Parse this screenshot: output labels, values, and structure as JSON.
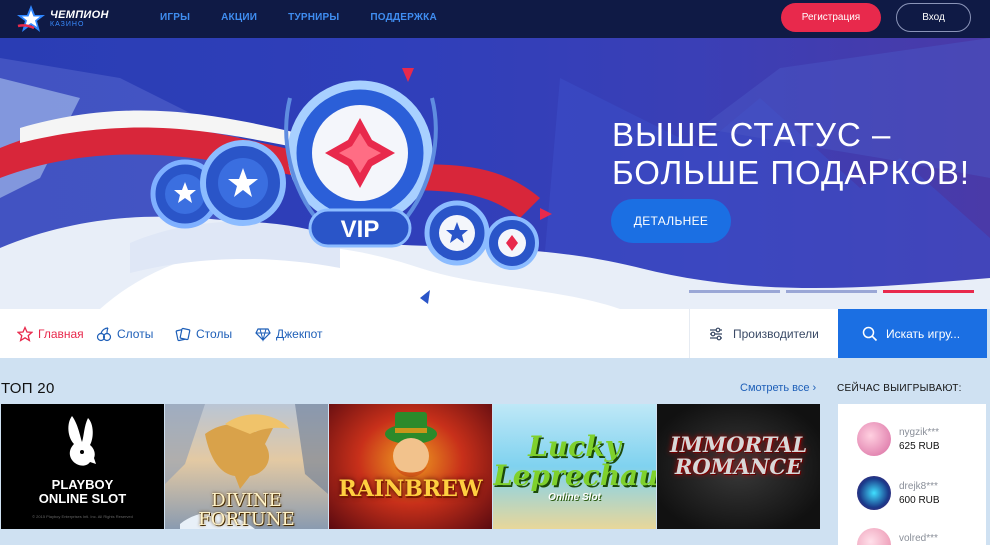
{
  "header": {
    "logo_main": "ЧЕМПИОН",
    "logo_sub": "КАЗИНО",
    "nav": [
      "ИГРЫ",
      "АКЦИИ",
      "ТУРНИРЫ",
      "ПОДДЕРЖКА"
    ],
    "register_label": "Регистрация",
    "login_label": "Вход"
  },
  "banner": {
    "title_line1": "ВЫШЕ СТАТУС –",
    "title_line2": "БОЛЬШЕ ПОДАРКОВ!",
    "button_label": "ДЕТАЛЬНЕЕ",
    "badge_text": "VIP",
    "slides_count": 3,
    "active_slide": 3
  },
  "categories": {
    "items": [
      {
        "label": "Главная",
        "icon": "star-icon",
        "active": true
      },
      {
        "label": "Слоты",
        "icon": "cherries-icon",
        "active": false
      },
      {
        "label": "Столы",
        "icon": "cards-icon",
        "active": false
      },
      {
        "label": "Джекпот",
        "icon": "diamond-icon",
        "active": false
      }
    ],
    "providers_label": "Производители",
    "search_placeholder": "Искать игру..."
  },
  "top": {
    "title": "ТОП 20",
    "see_all": "Смотреть все",
    "games": [
      {
        "line1": "PLAYBOY",
        "line2": "ONLINE SLOT",
        "small": "© 2015 Playboy Enterprises Intl. Inc. All Rights Reserved"
      },
      {
        "line1": "DIVINE FORTUNE"
      },
      {
        "line1": "RAINBREW"
      },
      {
        "line1": "Lucky",
        "line2": "Leprechaun",
        "line3": "Online Slot"
      },
      {
        "line1": "IMMORTAL",
        "line2": "ROMANCE"
      }
    ]
  },
  "winners": {
    "title": "СЕЙЧАС ВЫИГРЫВАЮТ:",
    "items": [
      {
        "name": "nygzik***",
        "amount": "625 RUB"
      },
      {
        "name": "drejk8***",
        "amount": "600 RUB"
      },
      {
        "name": "volred***",
        "amount": ""
      }
    ]
  },
  "colors": {
    "accent_red": "#e8294c",
    "accent_blue": "#1b6fe3",
    "header_bg": "#0f1a45"
  }
}
